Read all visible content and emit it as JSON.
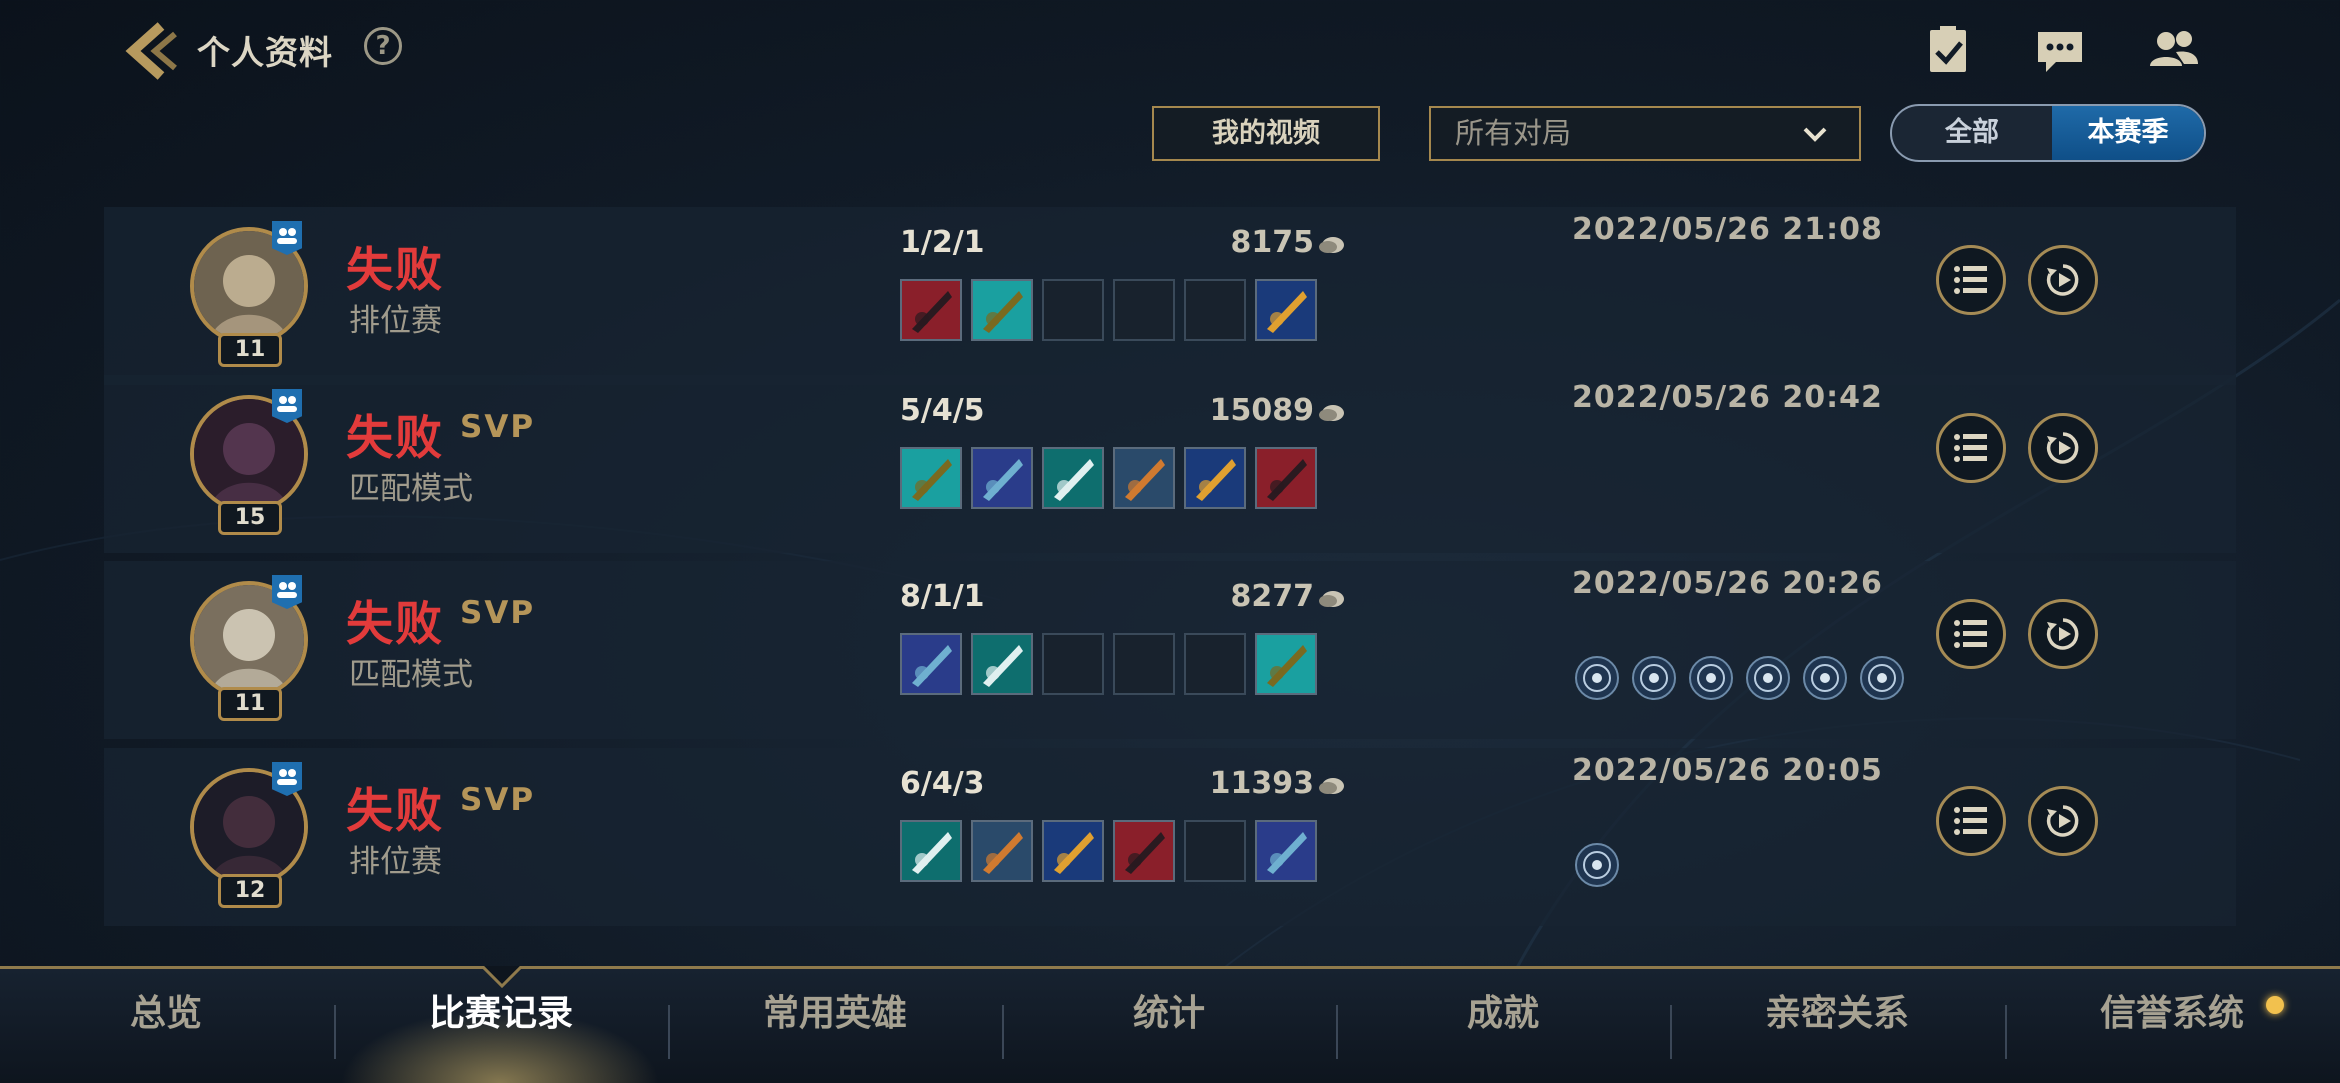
{
  "header": {
    "title": "个人资料",
    "help": "?"
  },
  "filters": {
    "my_videos": "我的视频",
    "game_filter": "所有对局",
    "season_all": "全部",
    "season_current": "本赛季"
  },
  "matches": [
    {
      "result": "失败",
      "svp": "",
      "mode": "排位赛",
      "level": "11",
      "kda": "1/2/1",
      "gold": "8175",
      "datetime": "2022/05/26 21:08",
      "items_filled": [
        true,
        true,
        false,
        false,
        false,
        true
      ],
      "runes": 0
    },
    {
      "result": "失败",
      "svp": "SVP",
      "mode": "匹配模式",
      "level": "15",
      "kda": "5/4/5",
      "gold": "15089",
      "datetime": "2022/05/26 20:42",
      "items_filled": [
        true,
        true,
        true,
        true,
        true,
        true
      ],
      "runes": 0
    },
    {
      "result": "失败",
      "svp": "SVP",
      "mode": "匹配模式",
      "level": "11",
      "kda": "8/1/1",
      "gold": "8277",
      "datetime": "2022/05/26 20:26",
      "items_filled": [
        true,
        true,
        false,
        false,
        false,
        true
      ],
      "runes": 6
    },
    {
      "result": "失败",
      "svp": "SVP",
      "mode": "排位赛",
      "level": "12",
      "kda": "6/4/3",
      "gold": "11393",
      "datetime": "2022/05/26 20:05",
      "items_filled": [
        true,
        true,
        true,
        true,
        false,
        true
      ],
      "runes": 1
    }
  ],
  "nav": {
    "tabs": [
      "总览",
      "比赛记录",
      "常用英雄",
      "统计",
      "成就",
      "亲密关系",
      "信誉系统"
    ],
    "active_index": 1
  },
  "colors": {
    "loss": "#e23b3b",
    "gold_accent": "#a5884e",
    "active_blue": "#1f6aa8"
  },
  "icons": {
    "back": "back-chevron-icon",
    "topbar": [
      "clipboard-check-icon",
      "chat-icon",
      "friends-icon"
    ],
    "row_buttons": [
      "list-icon",
      "replay-icon"
    ]
  }
}
